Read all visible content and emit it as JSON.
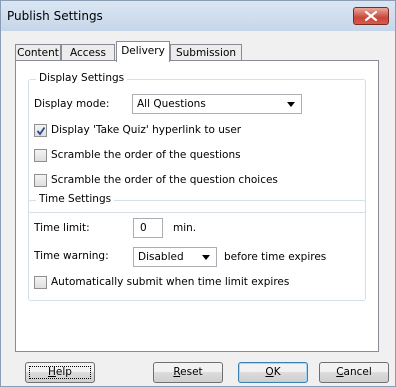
{
  "window": {
    "title": "Publish Settings"
  },
  "tabs": [
    {
      "label": "Content"
    },
    {
      "label": "Access"
    },
    {
      "label": "Delivery"
    },
    {
      "label": "Submission"
    }
  ],
  "display_settings": {
    "title": "Display Settings",
    "display_mode_label": "Display mode:",
    "display_mode_value": "All Questions",
    "show_hyperlink": {
      "label": "Display 'Take Quiz' hyperlink to user",
      "checked": true
    },
    "scramble_questions": {
      "label": "Scramble the order of the questions",
      "checked": false
    },
    "scramble_choices": {
      "label": "Scramble the order of the question choices",
      "checked": false
    }
  },
  "time_settings": {
    "title": "Time Settings",
    "time_limit_label": "Time limit:",
    "time_limit_value": "0",
    "time_limit_unit": "min.",
    "time_warning_label": "Time warning:",
    "time_warning_value": "Disabled",
    "time_warning_suffix": "before time expires",
    "auto_submit": {
      "label": "Automatically submit when time limit expires",
      "checked": false
    }
  },
  "buttons": {
    "help_prefix": "",
    "help_underline": "H",
    "help_rest": "elp",
    "reset_prefix": "",
    "reset_underline": "R",
    "reset_rest": "eset",
    "ok_prefix": "",
    "ok_underline": "O",
    "ok_rest": "K",
    "cancel_prefix": "",
    "cancel_underline": "C",
    "cancel_rest": "ancel"
  }
}
